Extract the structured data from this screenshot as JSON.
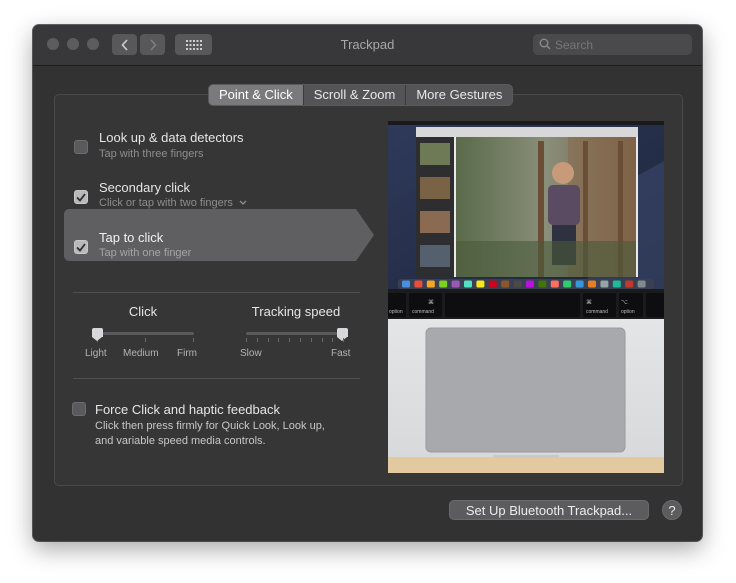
{
  "window": {
    "title": "Trackpad",
    "search_placeholder": "Search"
  },
  "tabs": [
    {
      "label": "Point & Click",
      "active": true
    },
    {
      "label": "Scroll & Zoom",
      "active": false
    },
    {
      "label": "More Gestures",
      "active": false
    }
  ],
  "options": {
    "lookup": {
      "title": "Look up & data detectors",
      "subtitle": "Tap with three fingers",
      "checked": false
    },
    "secondary": {
      "title": "Secondary click",
      "subtitle": "Click or tap with two fingers",
      "checked": true
    },
    "tap": {
      "title": "Tap to click",
      "subtitle": "Tap with one finger",
      "checked": true
    }
  },
  "sliders": {
    "click": {
      "title": "Click",
      "labels": [
        "Light",
        "Medium",
        "Firm"
      ],
      "value_index": 0
    },
    "tracking": {
      "title": "Tracking speed",
      "labels": [
        "Slow",
        "Fast"
      ],
      "value_fraction": 1.0
    }
  },
  "force_click": {
    "title": "Force Click and haptic feedback",
    "description_line1": "Click then press firmly for Quick Look, Look up,",
    "description_line2": "and variable speed media controls.",
    "checked": false
  },
  "preview": {
    "keys": {
      "option_left": "option",
      "command_left": "command",
      "command_right": "command",
      "option_right": "option",
      "cmd_symbol": "⌘",
      "alt_symbol": "⌥"
    }
  },
  "buttons": {
    "setup_bluetooth": "Set Up Bluetooth Trackpad...",
    "help": "?"
  },
  "colors": {
    "window_bg": "#323233",
    "panel_bg": "#363637",
    "highlight": "#5f5f61",
    "active_tab": "#7a7a7d"
  }
}
